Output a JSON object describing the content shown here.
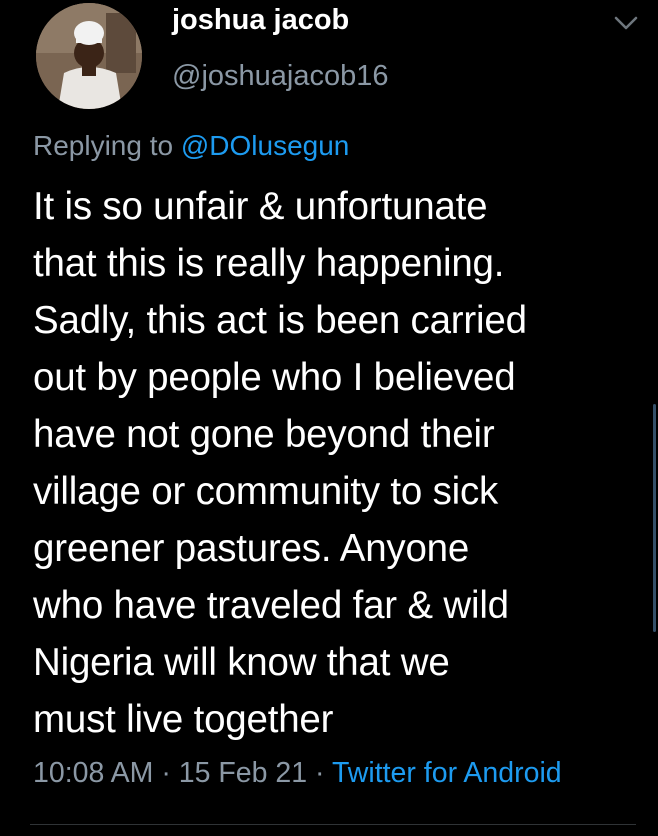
{
  "tweet": {
    "display_name": "joshua jacob",
    "handle": "@joshuajacob16",
    "replying_prefix": "Replying to",
    "replying_to": "@DOlusegun",
    "text": "It is so unfair & unfortunate\nthat this is really happening.\nSadly, this act is been carried\nout by people who I believed\nhave not gone beyond their\nvillage or community to sick\ngreener pastures. Anyone\nwho have traveled far & wild\nNigeria will know that we\nmust live together",
    "time": "10:08 AM",
    "separator": "·",
    "date": "15 Feb 21",
    "source": "Twitter for Android"
  },
  "icons": {
    "more": "chevron-down-icon",
    "avatar": "avatar"
  },
  "colors": {
    "background": "#000000",
    "primary_text": "#ffffff",
    "secondary_text": "#8b98a5",
    "link": "#1d9bf0"
  }
}
